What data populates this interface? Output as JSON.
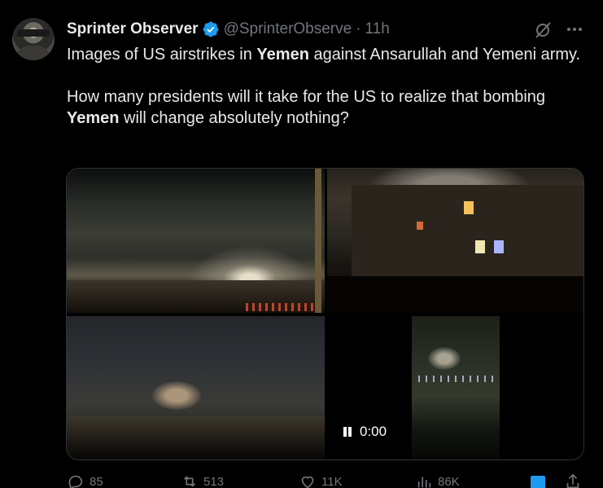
{
  "author": {
    "name": "Sprinter Observer",
    "handle": "@SprinterObserve",
    "separator": "·",
    "time": "11h",
    "verified_color": "#1d9bf0"
  },
  "tweet": {
    "line1_pre": "Images of US airstrikes in ",
    "line1_bold": "Yemen",
    "line1_post": " against Ansarullah and Yemeni army.",
    "line2_pre": "How many presidents will it take for the US to realize that bombing ",
    "line2_bold": "Yemen",
    "line2_post": " will change absolutely nothing?"
  },
  "media": {
    "video_time": "0:00",
    "video_state": "playing"
  },
  "actions": {
    "replies": "85",
    "reposts": "513",
    "likes": "11K",
    "views": "86K"
  },
  "icons": {
    "grok": "grok-icon",
    "more": "more-icon",
    "reply": "reply-icon",
    "repost": "repost-icon",
    "like": "heart-icon",
    "views": "views-icon",
    "bookmark": "bookmark-icon",
    "share": "share-icon",
    "pause": "pause-icon"
  },
  "colors": {
    "background": "#000000",
    "text": "#e7e9ea",
    "muted": "#71767b",
    "accent": "#1d9bf0"
  }
}
